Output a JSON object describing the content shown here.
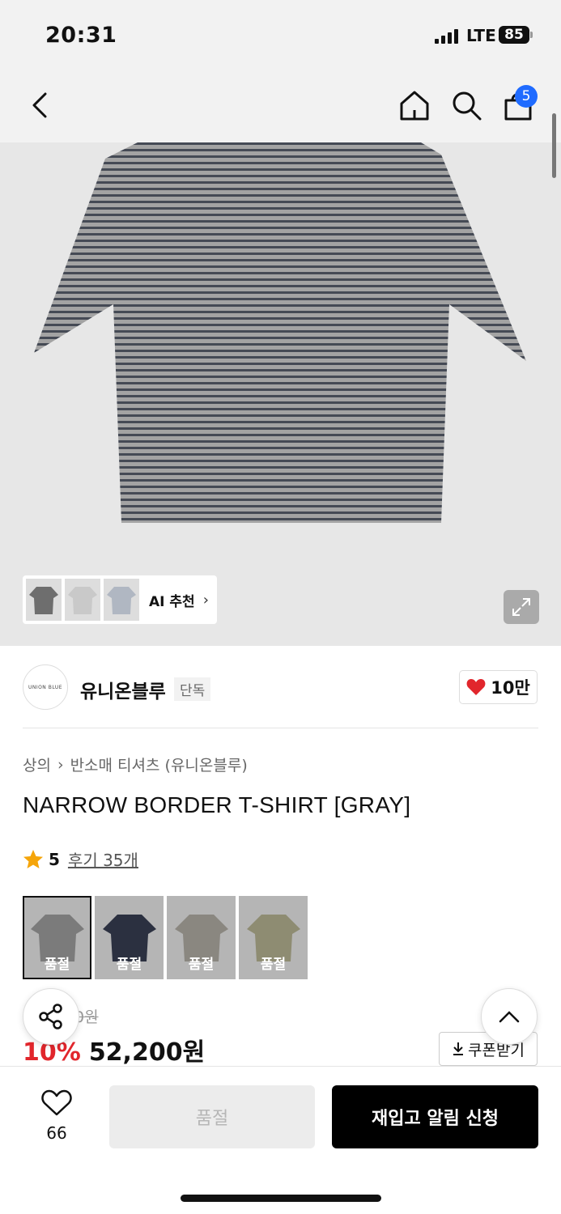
{
  "status_bar": {
    "time": "20:31",
    "network": "LTE",
    "battery": "85"
  },
  "nav": {
    "cart_count": "5",
    "icons": [
      "back-icon",
      "home-icon",
      "search-icon",
      "cart-icon"
    ]
  },
  "hero": {
    "ai_recommend_label": "AI 추천",
    "colors": {
      "background": "#e7e7e7",
      "shirt_base": "#9a9a9a",
      "shirt_stripe": "#3f4450"
    }
  },
  "brand": {
    "logo_text": "UNION BLUE",
    "name": "유니온블루",
    "tag": "단독",
    "likes": "10만"
  },
  "breadcrumb": {
    "category": "상의",
    "subcategory": "반소매 티셔츠 (유니온블루)"
  },
  "product": {
    "title": "NARROW BORDER T-SHIRT [GRAY]",
    "rating": "5",
    "review_text": "후기 35개",
    "original_price_partial": "0원",
    "discount": "10%",
    "price": "52,200원",
    "coupon_label": "쿠폰받기"
  },
  "color_options": [
    {
      "soldout_label": "품절",
      "shirt_color": "#7b7b7b",
      "selected": true
    },
    {
      "soldout_label": "품절",
      "shirt_color": "#2b3040",
      "selected": false
    },
    {
      "soldout_label": "품절",
      "shirt_color": "#8a8780",
      "selected": false
    },
    {
      "soldout_label": "품절",
      "shirt_color": "#8e8c72",
      "selected": false
    }
  ],
  "bottom_bar": {
    "wish_count": "66",
    "soldout_label": "품절",
    "restock_label": "재입고 알림 신청"
  },
  "accent_colors": {
    "discount_red": "#e1262c",
    "heart_red": "#e1262c",
    "badge_blue": "#1f6bff"
  }
}
